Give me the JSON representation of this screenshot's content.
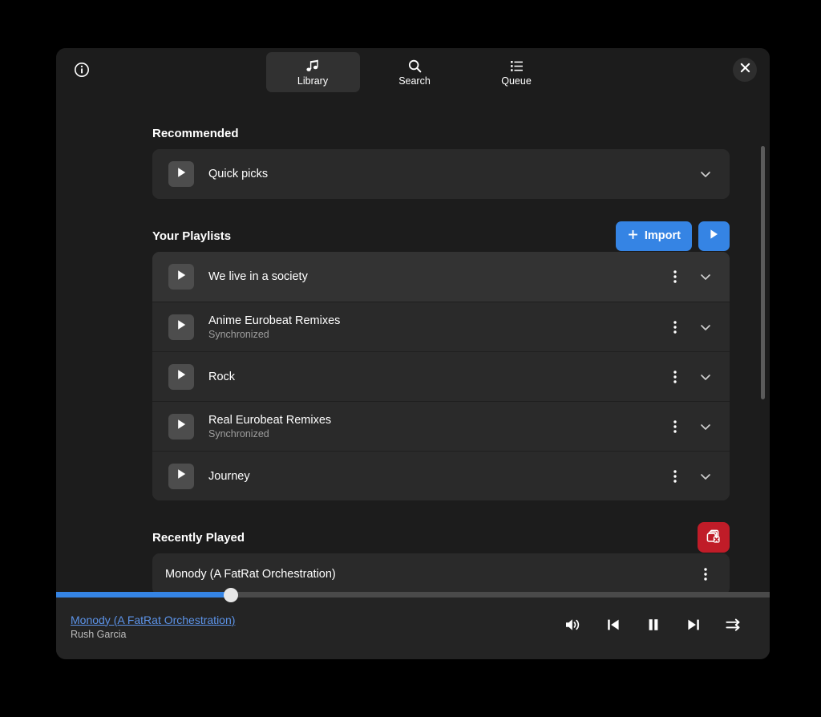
{
  "window": {
    "info_icon": "info-circle-icon",
    "close_icon": "close-icon"
  },
  "header": {
    "tabs": [
      {
        "label": "Library",
        "icon": "music-note-icon",
        "active": true
      },
      {
        "label": "Search",
        "icon": "search-icon",
        "active": false
      },
      {
        "label": "Queue",
        "icon": "queue-list-icon",
        "active": false
      }
    ]
  },
  "sections": {
    "recommended": {
      "title": "Recommended",
      "items": [
        {
          "title": "Quick picks",
          "play_icon": "play-icon",
          "expand_icon": "chevron-down-icon"
        }
      ]
    },
    "playlists": {
      "title": "Your Playlists",
      "import_label": "Import",
      "import_icon": "plus-icon",
      "play_all_icon": "play-icon",
      "items": [
        {
          "title": "We live in a society",
          "subtitle": "",
          "hover": true
        },
        {
          "title": "Anime Eurobeat Remixes",
          "subtitle": "Synchronized",
          "hover": false
        },
        {
          "title": "Rock",
          "subtitle": "",
          "hover": false
        },
        {
          "title": "Real Eurobeat Remixes",
          "subtitle": "Synchronized",
          "hover": false
        },
        {
          "title": "Journey",
          "subtitle": "",
          "hover": false
        }
      ],
      "menu_icon": "more-vertical-icon",
      "expand_icon": "chevron-down-icon"
    },
    "recently_played": {
      "title": "Recently Played",
      "clear_icon": "clear-history-icon",
      "items": [
        {
          "title": "Monody (A FatRat Orchestration)",
          "menu_icon": "more-vertical-icon"
        }
      ]
    }
  },
  "player": {
    "track_title": "Monody (A FatRat Orchestration)",
    "track_artist": "Rush Garcia",
    "progress_percent": 24.5,
    "controls": [
      {
        "name": "volume-icon",
        "label": "Volume"
      },
      {
        "name": "previous-icon",
        "label": "Previous"
      },
      {
        "name": "pause-icon",
        "label": "Pause"
      },
      {
        "name": "next-icon",
        "label": "Next"
      },
      {
        "name": "shuffle-icon",
        "label": "Shuffle"
      }
    ]
  },
  "colors": {
    "accent_blue": "#3584e4",
    "danger_red": "#c01c28",
    "window_bg": "#1c1c1c",
    "card_bg": "#2a2a2a",
    "player_bg": "#242424",
    "link_blue": "#5c93e8"
  }
}
